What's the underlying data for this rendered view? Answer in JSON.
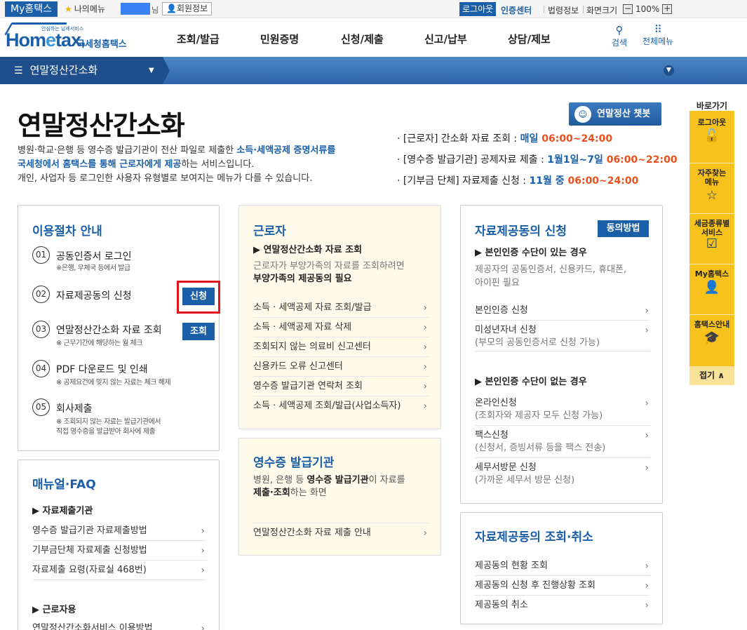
{
  "topbar": {
    "myhome": "My홈택스",
    "mymenu": "나의메뉴",
    "user_suffix": "님",
    "member_info": "회원정보",
    "logout": "로그아웃",
    "cert_center": "인증센터",
    "law_info": "법령정보",
    "screen_size": "화면크기",
    "zoom_minus": "−",
    "zoom_level": "100%",
    "zoom_plus": "+"
  },
  "header": {
    "logo_sub": "안심하는 납세서비스",
    "logo_main_a": "Hom",
    "logo_main_b": "e",
    "logo_main_c": "tax.",
    "logo_ko": "국세청홈택스",
    "gnb": [
      "조회/발급",
      "민원증명",
      "신청/제출",
      "신고/납부",
      "상담/제보"
    ],
    "search": "검색",
    "all_menu": "전체메뉴"
  },
  "nav": {
    "current": "연말정산간소화"
  },
  "page": {
    "title": "연말정산간소화",
    "desc_1a": "병원·학교·은행 등 영수증 발급기관이 전산 파일로 제출한 ",
    "desc_1b": "소득·세액공제 증명서류를",
    "desc_2a": "국세청에서 홈택스를 통해 근로자에게 제공",
    "desc_2b": "하는 서비스입니다.",
    "desc_3": "개인, 사업자 등 로그인한 사용자 유형별로 보여지는 메뉴가 다를 수 있습니다.",
    "chatbot": "연말정산 챗봇"
  },
  "schedule": [
    {
      "label": "· [근로자] 간소화 자료 조회 : ",
      "period": "매일 ",
      "time": "06:00~24:00"
    },
    {
      "label": "· [영수증 발급기관] 공제자료 제출 : ",
      "period": "1월1일~7일 ",
      "time": "06:00~22:00"
    },
    {
      "label": "· [기부금 단체] 자료제출 신청 : ",
      "period": "11월 중 ",
      "time": "06:00~24:00"
    }
  ],
  "procedure": {
    "title": "이용절차 안내",
    "steps": [
      {
        "num": "01",
        "label": "공동인증서 로그인",
        "note": "※은행, 우체국 등에서 발급"
      },
      {
        "num": "02",
        "label": "자료제공동의 신청",
        "note": "",
        "btn": "신청"
      },
      {
        "num": "03",
        "label": "연말정산간소화 자료 조회",
        "note": "※ 근무기간에 해당하는 월 체크",
        "btn": "조회"
      },
      {
        "num": "04",
        "label": "PDF 다운로드 및 인쇄",
        "note": "※ 공제요건에 맞지 않는 자료는 체크 해제"
      },
      {
        "num": "05",
        "label": "회사제출",
        "note": "※ 조회되지 않는 자료는 발급기관에서",
        "note2": "직접 영수증을 발급받아 회사에 제출"
      }
    ]
  },
  "manual": {
    "title": "매뉴얼·FAQ",
    "sub1": "▶ 자료제출기관",
    "links1": [
      "영수증 발급기관 자료제출방법",
      "기부금단체 자료제출 신청방법",
      "자료제출 요령(자료실 468번)"
    ],
    "sub2": "▶ 근로자용",
    "links2": [
      "연말정산간소화서비스 이용방법"
    ]
  },
  "worker": {
    "title": "근로자",
    "sub": "▶ 연말정산간소화 자료 조회",
    "desc_1": "근로자가 부양가족의 자료를 조회하려면",
    "desc_2": "부양가족의 제공동의 필요",
    "links": [
      "소득 · 세액공제 자료 조회/발급",
      "소득 · 세액공제 자료 삭제",
      "조회되지 않는 의료비 신고센터",
      "신용카드 오류 신고센터",
      "영수증 발급기관 연락처 조회",
      "소득 · 세액공제 조회/발급(사업소득자)"
    ]
  },
  "issuer": {
    "title": "영수증 발급기관",
    "desc_1a": "병원, 은행 등 ",
    "desc_1b": "영수증 발급기관",
    "desc_1c": "이 자료를",
    "desc_2a": "제출·조회",
    "desc_2b": "하는 화면",
    "links": [
      "연말정산간소화 자료 제출 안내"
    ]
  },
  "consent": {
    "title": "자료제공동의 신청",
    "btn": "동의방법",
    "sub1": "▶ 본인인증 수단이 있는 경우",
    "desc1": "제공자의 공동인증서, 신용카드, 휴대폰,",
    "desc2": "아이핀 필요",
    "links1": [
      "본인인증 신청",
      "미성년자녀 신청"
    ],
    "links1_note": [
      "",
      "(부모의 공동인증서로 신청 가능)"
    ],
    "sub2": "▶ 본인인증 수단이 없는 경우",
    "links2": [
      "온라인신청",
      "팩스신청",
      "세무서방문 신청"
    ],
    "links2_note": [
      "(조회자와 제공자 모두 신청 가능)",
      "(신청서, 증빙서류 등을 팩스 전송)",
      "(가까운 세무서 방문 신청)"
    ]
  },
  "cancel": {
    "title": "자료제공동의 조회·취소",
    "links": [
      "제공동의 현황 조회",
      "제공동의 신청 후 진행상황 조회",
      "제공동의 취소"
    ]
  },
  "quick": {
    "title": "바로가기",
    "items": [
      {
        "label1": "로그아웃",
        "label2": ""
      },
      {
        "label1": "자주찾는",
        "label2": "메뉴"
      },
      {
        "label1": "세금종류별",
        "label2": "서비스"
      },
      {
        "label1": "My홈택스",
        "label2": ""
      },
      {
        "label1": "홈택스안내",
        "label2": ""
      }
    ],
    "fold": "접기"
  }
}
